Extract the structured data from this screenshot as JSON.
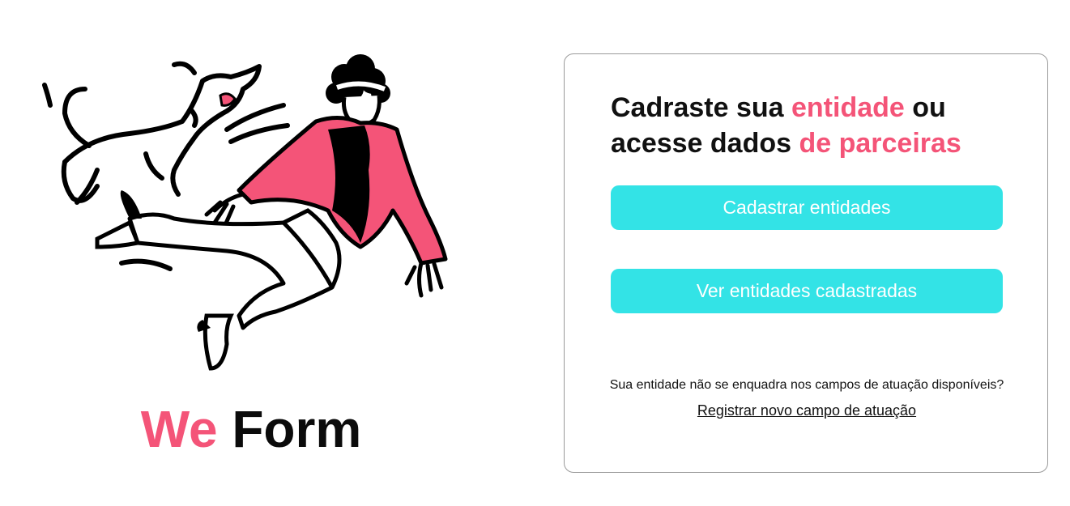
{
  "brand": {
    "part1": "We",
    "part2": "Form",
    "accent_color": "#F45478"
  },
  "illustration": {
    "icon": "jumping-person-with-dog-illustration"
  },
  "card": {
    "headline": {
      "t1": "Cadraste sua ",
      "t2": "entidade",
      "t3": " ou",
      "t4": "acesse dados ",
      "t5": "de parceiras"
    },
    "register_button": "Cadastrar entidades",
    "view_button": "Ver entidades cadastradas",
    "button_color": "#33E3E6",
    "footnote": "Sua entidade não se enquadra nos campos de atuação disponíveis?",
    "register_field_link": "Registrar novo campo de atuação"
  }
}
